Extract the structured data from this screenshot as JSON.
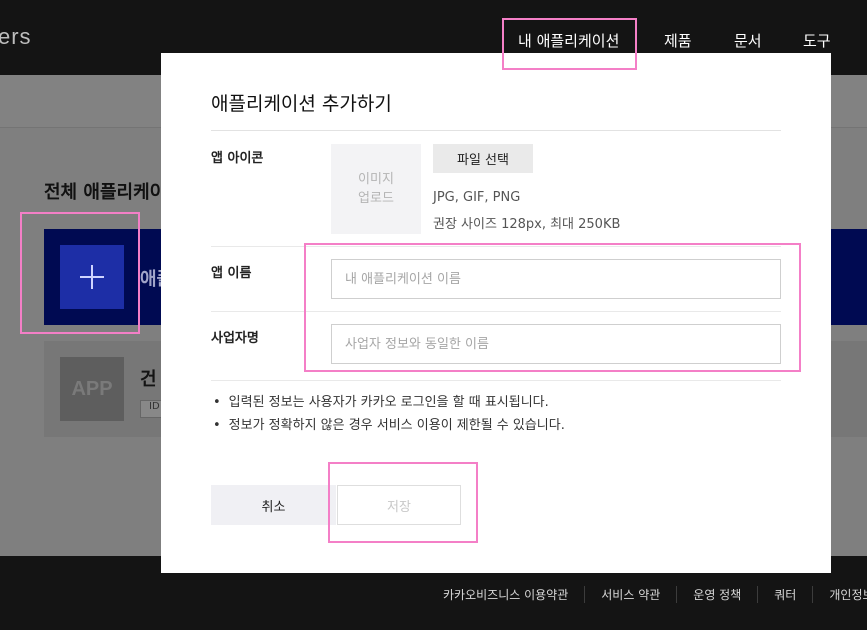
{
  "nav": {
    "brand": "ers",
    "items": [
      "내 애플리케이션",
      "제품",
      "문서",
      "도구"
    ]
  },
  "page": {
    "heading": "전체 애플리케이션",
    "add_app_label": "애플리케이션 추가하기",
    "app_card": {
      "thumb": "APP",
      "name": "건",
      "id_tag": "ID"
    }
  },
  "modal": {
    "title": "애플리케이션 추가하기",
    "icon_label": "앱 아이콘",
    "upload_line1": "이미지",
    "upload_line2": "업로드",
    "file_button": "파일 선택",
    "file_hint1": "JPG, GIF, PNG",
    "file_hint2": "권장 사이즈 128px, 최대 250KB",
    "name_label": "앱 이름",
    "name_placeholder": "내 애플리케이션 이름",
    "biz_label": "사업자명",
    "biz_placeholder": "사업자 정보와 동일한 이름",
    "notices": [
      "입력된 정보는 사용자가 카카오 로그인을 할 때 표시됩니다.",
      "정보가 정확하지 않은 경우 서비스 이용이 제한될 수 있습니다."
    ],
    "cancel_button": "취소",
    "save_button": "저장"
  },
  "footer": {
    "links": [
      "카카오비즈니스 이용약관",
      "서비스 약관",
      "운영 정책",
      "쿼터",
      "개인정보"
    ]
  },
  "colors": {
    "highlight": "#f47fc7",
    "nav_bg": "#141414",
    "add_card_bg": "#000a52",
    "add_button_bg": "#1d2ea6"
  }
}
